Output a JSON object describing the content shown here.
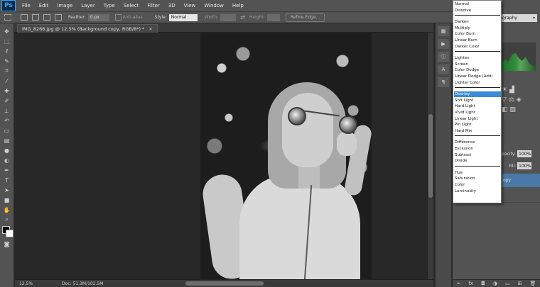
{
  "app": {
    "logo": "Ps"
  },
  "menubar": {
    "items": [
      "File",
      "Edit",
      "Image",
      "Layer",
      "Type",
      "Select",
      "Filter",
      "3D",
      "View",
      "Window",
      "Help"
    ]
  },
  "options": {
    "feather_label": "Feather:",
    "feather_value": "0 px",
    "antialias_label": "Anti-alias",
    "style_label": "Style:",
    "style_value": "Normal",
    "width_label": "Width:",
    "height_label": "Height:",
    "refine_label": "Refine Edge..."
  },
  "document": {
    "tab": "IMG_8268.jpg @ 12.5% (Background copy, RGB/8*) *"
  },
  "status": {
    "zoom": "12.5%",
    "doc": "Doc: 51.3M/102.5M"
  },
  "workspace": {
    "value": "ography"
  },
  "layers": {
    "opacity_label": "pacity:",
    "opacity_value": "100%",
    "fill_label": "Fill:",
    "fill_value": "100%",
    "selected_layer": "opy"
  },
  "blend_menu": {
    "groups": [
      [
        "Normal",
        "Dissolve"
      ],
      [
        "Darken",
        "Multiply",
        "Color Burn",
        "Linear Burn",
        "Darker Color"
      ],
      [
        "Lighten",
        "Screen",
        "Color Dodge",
        "Linear Dodge (Add)",
        "Lighter Color"
      ],
      [
        "Overlay",
        "Soft Light",
        "Hard Light",
        "Vivid Light",
        "Linear Light",
        "Pin Light",
        "Hard Mix"
      ],
      [
        "Difference",
        "Exclusion",
        "Subtract",
        "Divide"
      ],
      [
        "Hue",
        "Saturation",
        "Color",
        "Luminosity"
      ]
    ],
    "selected": "Overlay"
  },
  "colors": {
    "accent": "#3b8bd6",
    "ui": "#535353",
    "canvas": "#282828",
    "ps_blue": "#31a8ff"
  }
}
